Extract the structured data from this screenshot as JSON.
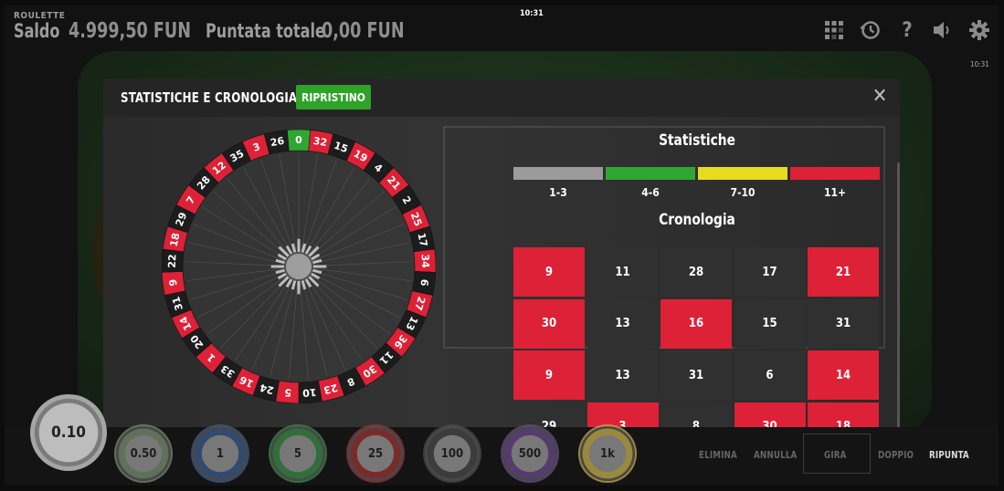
{
  "header": {
    "game_name": "ROULETTE",
    "balance_label": "Saldo",
    "balance_value": "4.999,50 FUN",
    "bet_label": "Puntata totale",
    "bet_value": "0,00 FUN",
    "clock": "10:31",
    "clock_secondary": "10:31",
    "icons": [
      "layout-icon",
      "history-icon",
      "help-icon",
      "sound-icon",
      "settings-icon"
    ]
  },
  "modal": {
    "title": "STATISTICHE E CRONOLOGIA",
    "reset_label": "RIPRISTINO",
    "close_glyph": "✕",
    "stats_title": "Statistiche",
    "history_title": "Cronologia",
    "stats": [
      {
        "label": "1-3",
        "color": "#9b9b9b"
      },
      {
        "label": "4-6",
        "color": "#2fa632"
      },
      {
        "label": "7-10",
        "color": "#e5dc20"
      },
      {
        "label": "11+",
        "color": "#dd2137"
      }
    ],
    "history": [
      {
        "n": "9",
        "c": "red"
      },
      {
        "n": "11",
        "c": "black"
      },
      {
        "n": "28",
        "c": "black"
      },
      {
        "n": "17",
        "c": "black"
      },
      {
        "n": "21",
        "c": "red"
      },
      {
        "n": "30",
        "c": "red"
      },
      {
        "n": "13",
        "c": "black"
      },
      {
        "n": "16",
        "c": "red"
      },
      {
        "n": "15",
        "c": "black"
      },
      {
        "n": "31",
        "c": "black"
      },
      {
        "n": "9",
        "c": "red"
      },
      {
        "n": "13",
        "c": "black"
      },
      {
        "n": "31",
        "c": "black"
      },
      {
        "n": "6",
        "c": "black"
      },
      {
        "n": "14",
        "c": "red"
      },
      {
        "n": "29",
        "c": "black"
      },
      {
        "n": "3",
        "c": "red"
      },
      {
        "n": "8",
        "c": "black"
      },
      {
        "n": "30",
        "c": "red"
      },
      {
        "n": "18",
        "c": "red"
      }
    ]
  },
  "wheel": {
    "numbers": [
      "0",
      "32",
      "15",
      "19",
      "4",
      "21",
      "2",
      "25",
      "17",
      "34",
      "6",
      "27",
      "13",
      "36",
      "11",
      "30",
      "8",
      "23",
      "10",
      "5",
      "24",
      "16",
      "33",
      "1",
      "20",
      "14",
      "31",
      "9",
      "22",
      "18",
      "29",
      "7",
      "28",
      "12",
      "35",
      "3",
      "26"
    ],
    "red_numbers": [
      "32",
      "19",
      "21",
      "25",
      "34",
      "27",
      "36",
      "30",
      "23",
      "5",
      "16",
      "1",
      "14",
      "9",
      "18",
      "7",
      "12",
      "3"
    ],
    "colors": {
      "red": "#dd2137",
      "black": "#1c1c1c",
      "green": "#2fa632"
    }
  },
  "chips": {
    "selected": "0.10",
    "values": [
      "0.50",
      "1",
      "5",
      "25",
      "100",
      "500",
      "1k"
    ],
    "colors": [
      "#7a8f73",
      "#3b5c8c",
      "#3c8c4a",
      "#9b3333",
      "#4a4a4a",
      "#6b4a8c",
      "#c7b14a"
    ]
  },
  "actions": {
    "clear": "ELIMINA",
    "undo": "ANNULLA",
    "spin": "GIRA",
    "double": "DOPPIO",
    "rebet": "RIPUNTA"
  }
}
